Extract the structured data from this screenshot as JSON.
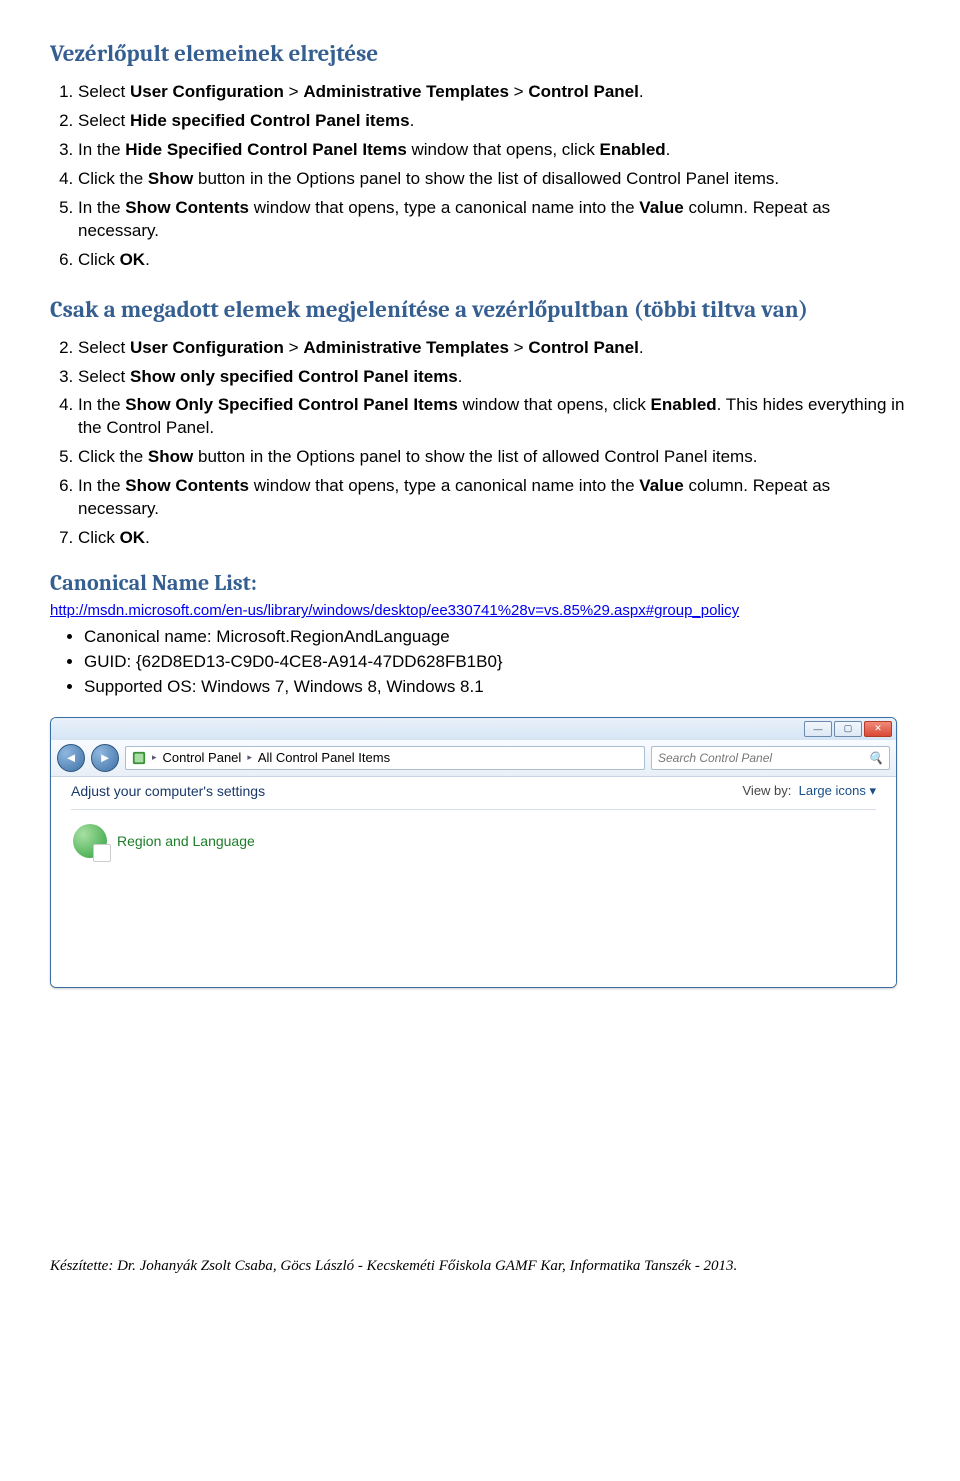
{
  "heading1": "Vezérlőpult elemeinek elrejtése",
  "list1": {
    "i1": {
      "pre": "Select ",
      "b1": "User Configuration",
      "mid": " > ",
      "b2": "Administrative Templates",
      "mid2": " > ",
      "b3": "Control Panel",
      "post": "."
    },
    "i2": {
      "pre": "Select ",
      "b": "Hide specified Control Panel items",
      "post": "."
    },
    "i3": {
      "pre": "In the ",
      "b1": "Hide Specified Control Panel Items",
      "mid": " window that opens, click ",
      "b2": "Enabled",
      "post": "."
    },
    "i4": {
      "pre": "Click the ",
      "b": "Show",
      "post": " button in the Options panel to show the list of disallowed Control Panel items."
    },
    "i5": {
      "pre": "In the ",
      "b1": "Show Contents",
      "mid": " window that opens, type a canonical name into the ",
      "b2": "Value",
      "post": " column. Repeat as necessary."
    },
    "i6": {
      "pre": "Click ",
      "b": "OK",
      "post": "."
    }
  },
  "heading2": "Csak a megadott elemek megjelenítése a vezérlőpultban (többi tiltva van)",
  "list2": {
    "i2": {
      "pre": "Select ",
      "b1": "User Configuration",
      "mid": " > ",
      "b2": "Administrative Templates",
      "mid2": " > ",
      "b3": "Control Panel",
      "post": "."
    },
    "i3": {
      "pre": "Select ",
      "b": "Show only specified Control Panel items",
      "post": "."
    },
    "i4": {
      "pre": "In the ",
      "b1": "Show Only Specified Control Panel Items",
      "mid": " window that opens, click ",
      "b2": "Enabled",
      "post": ". This hides everything in the Control Panel."
    },
    "i5": {
      "pre": "Click the ",
      "b": "Show",
      "post": " button in the Options panel to show the list of allowed Control Panel items."
    },
    "i6": {
      "pre": "In the ",
      "b1": "Show Contents",
      "mid": " window that opens, type a canonical name into the ",
      "b2": "Value",
      "post": " column. Repeat as necessary."
    },
    "i7": {
      "pre": "Click ",
      "b": "OK",
      "post": "."
    }
  },
  "heading3": "Canonical Name List:",
  "link": "http://msdn.microsoft.com/en-us/library/windows/desktop/ee330741%28v=vs.85%29.aspx#group_policy",
  "bullets": {
    "b1": "Canonical name: Microsoft.RegionAndLanguage",
    "b2": "GUID: {62D8ED13-C9D0-4CE8-A914-47DD628FB1B0}",
    "b3": "Supported OS: Windows 7, Windows 8, Windows 8.1"
  },
  "cp": {
    "path1": "Control Panel",
    "path2": "All Control Panel Items",
    "searchPH": "Search Control Panel",
    "adjust": "Adjust your computer's settings",
    "viewby_label": "View by:",
    "viewby_value": "Large icons ▾",
    "item": "Region and Language"
  },
  "footer": "Készítette: Dr. Johanyák Zsolt Csaba, Göcs László - Kecskeméti Főiskola GAMF Kar, Informatika Tanszék - 2013."
}
